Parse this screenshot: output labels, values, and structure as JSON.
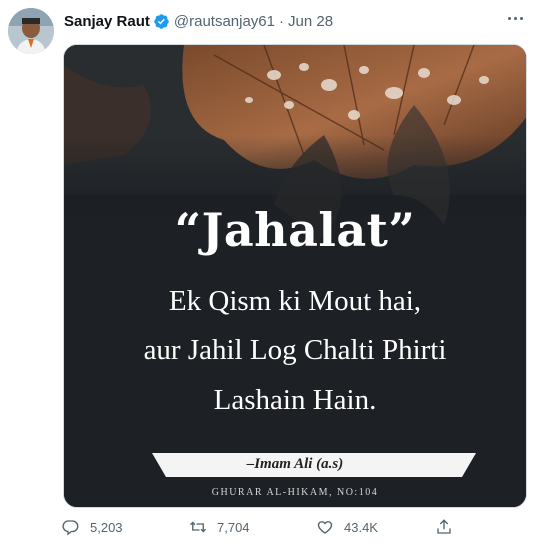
{
  "tweet": {
    "author_name": "Sanjay Raut",
    "handle": "@rautsanjay61",
    "separator": "·",
    "date": "Jun 28",
    "verified": true
  },
  "image": {
    "title": "“Jahalat”",
    "lines": [
      "Ek Qism ki Mout hai,",
      "aur Jahil Log Chalti Phirti",
      "Lashain Hain."
    ],
    "attribution": "–Imam Ali (a.s)",
    "source": "GHURAR AL-HIKAM, NO:104"
  },
  "actions": {
    "replies": "5,203",
    "retweets": "7,704",
    "likes": "43.4K"
  },
  "colors": {
    "verified_blue": "#1d9bf0",
    "secondary_text": "#536471"
  }
}
